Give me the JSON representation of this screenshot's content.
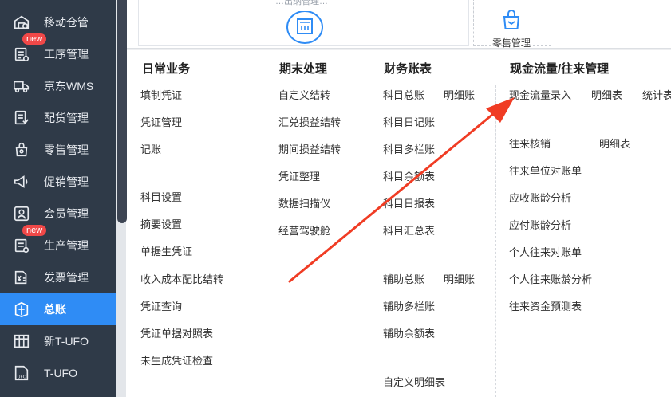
{
  "sidebar": {
    "items": [
      {
        "label": "移动仓管",
        "icon": "warehouse-mobile-icon"
      },
      {
        "label": "工序管理",
        "icon": "process-icon",
        "badge": "new"
      },
      {
        "label": "京东WMS",
        "icon": "truck-icon"
      },
      {
        "label": "配货管理",
        "icon": "distribution-icon"
      },
      {
        "label": "零售管理",
        "icon": "retail-icon"
      },
      {
        "label": "促销管理",
        "icon": "megaphone-icon"
      },
      {
        "label": "会员管理",
        "icon": "member-icon"
      },
      {
        "label": "生产管理",
        "icon": "production-icon",
        "badge": "new"
      },
      {
        "label": "发票管理",
        "icon": "invoice-icon"
      },
      {
        "label": "总账",
        "icon": "ledger-icon",
        "active": true
      },
      {
        "label": "新T-UFO",
        "icon": "report-icon"
      },
      {
        "label": "T-UFO",
        "icon": "ufo-icon"
      }
    ]
  },
  "top": {
    "faint_label": "…出纳管理…",
    "retail_label": "零售管理"
  },
  "menu": {
    "columns": [
      {
        "heading": "日常业务",
        "items": [
          "填制凭证",
          "凭证管理",
          "记账",
          "科目设置",
          "摘要设置",
          "单据生凭证",
          "收入成本配比结转",
          "凭证查询",
          "凭证单据对照表",
          "未生成凭证检查"
        ]
      },
      {
        "heading": "期末处理",
        "items": [
          "自定义结转",
          "汇兑损益结转",
          "期间损益结转",
          "凭证整理",
          "数据扫描仪",
          "经营驾驶舱"
        ]
      },
      {
        "heading": "财务账表",
        "items": [
          "科目总账",
          "明细账",
          "科目日记账",
          "科目多栏账",
          "科目余额表",
          "科目日报表",
          "科目汇总表",
          "辅助总账",
          "明细账",
          "辅助多栏账",
          "辅助余额表",
          "自定义明细表"
        ]
      },
      {
        "heading": "现金流量/往来管理",
        "items": [
          "现金流量录入",
          "明细表",
          "统计表",
          "往来核销",
          "明细表",
          "往来单位对账单",
          "应收账龄分析",
          "应付账龄分析",
          "个人往来对账单",
          "个人往来账龄分析",
          "往来资金预测表"
        ]
      }
    ]
  },
  "annotation": {
    "arrow_color": "#f03c24"
  }
}
